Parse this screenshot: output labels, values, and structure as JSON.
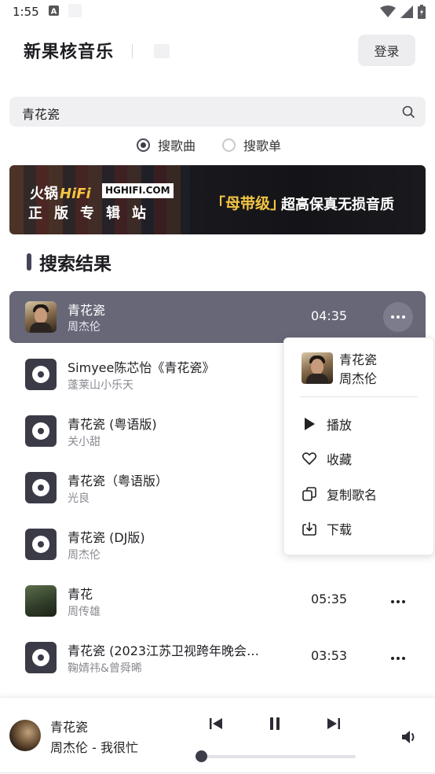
{
  "status_bar": {
    "time": "1:55",
    "icons": [
      "keyboard-a-icon",
      "blank-notification-icon",
      "wifi-icon",
      "signal-icon",
      "battery-icon"
    ]
  },
  "header": {
    "app_title": "新果核音乐",
    "login_label": "登录"
  },
  "search": {
    "value": "青花瓷",
    "icon": "search-icon"
  },
  "search_mode": {
    "options": [
      {
        "label": "搜歌曲",
        "checked": true
      },
      {
        "label": "搜歌单",
        "checked": false
      }
    ]
  },
  "banner": {
    "brand": "火锅",
    "brand_accent": "HiFi",
    "site": "HGHIFI.COM",
    "subtitle": "正版专辑站",
    "tag": "「母带级」",
    "slogan": "超高保真无损音质"
  },
  "results": {
    "heading": "搜索结果",
    "songs": [
      {
        "title": "青花瓷",
        "artist": "周杰伦",
        "duration": "04:35",
        "cover": "photo",
        "selected": true
      },
      {
        "title": "Simyee陈芯怡《青花瓷》",
        "artist": "蓬莱山小乐天",
        "duration": "",
        "cover": "disc",
        "selected": false
      },
      {
        "title": "青花瓷 (粤语版)",
        "artist": "关小甜",
        "duration": "",
        "cover": "disc",
        "selected": false
      },
      {
        "title": "青花瓷（粤语版）",
        "artist": "光良",
        "duration": "",
        "cover": "disc",
        "selected": false
      },
      {
        "title": "青花瓷 (DJ版)",
        "artist": "周杰伦",
        "duration": "",
        "cover": "disc",
        "selected": false
      },
      {
        "title": "青花",
        "artist": "周传雄",
        "duration": "05:35",
        "cover": "green",
        "selected": false
      },
      {
        "title": "青花瓷 (2023江苏卫视跨年晚会…",
        "artist": "鞠婧祎&曾舜晞",
        "duration": "03:53",
        "cover": "disc",
        "selected": false
      }
    ]
  },
  "context_menu": {
    "song_title": "青花瓷",
    "song_artist": "周杰伦",
    "items": [
      {
        "label": "播放",
        "icon": "play-icon"
      },
      {
        "label": "收藏",
        "icon": "heart-icon"
      },
      {
        "label": "复制歌名",
        "icon": "copy-icon"
      },
      {
        "label": "下载",
        "icon": "download-icon"
      }
    ]
  },
  "player": {
    "title": "青花瓷",
    "subtitle": "周杰伦 - 我很忙",
    "progress": 0.0
  }
}
